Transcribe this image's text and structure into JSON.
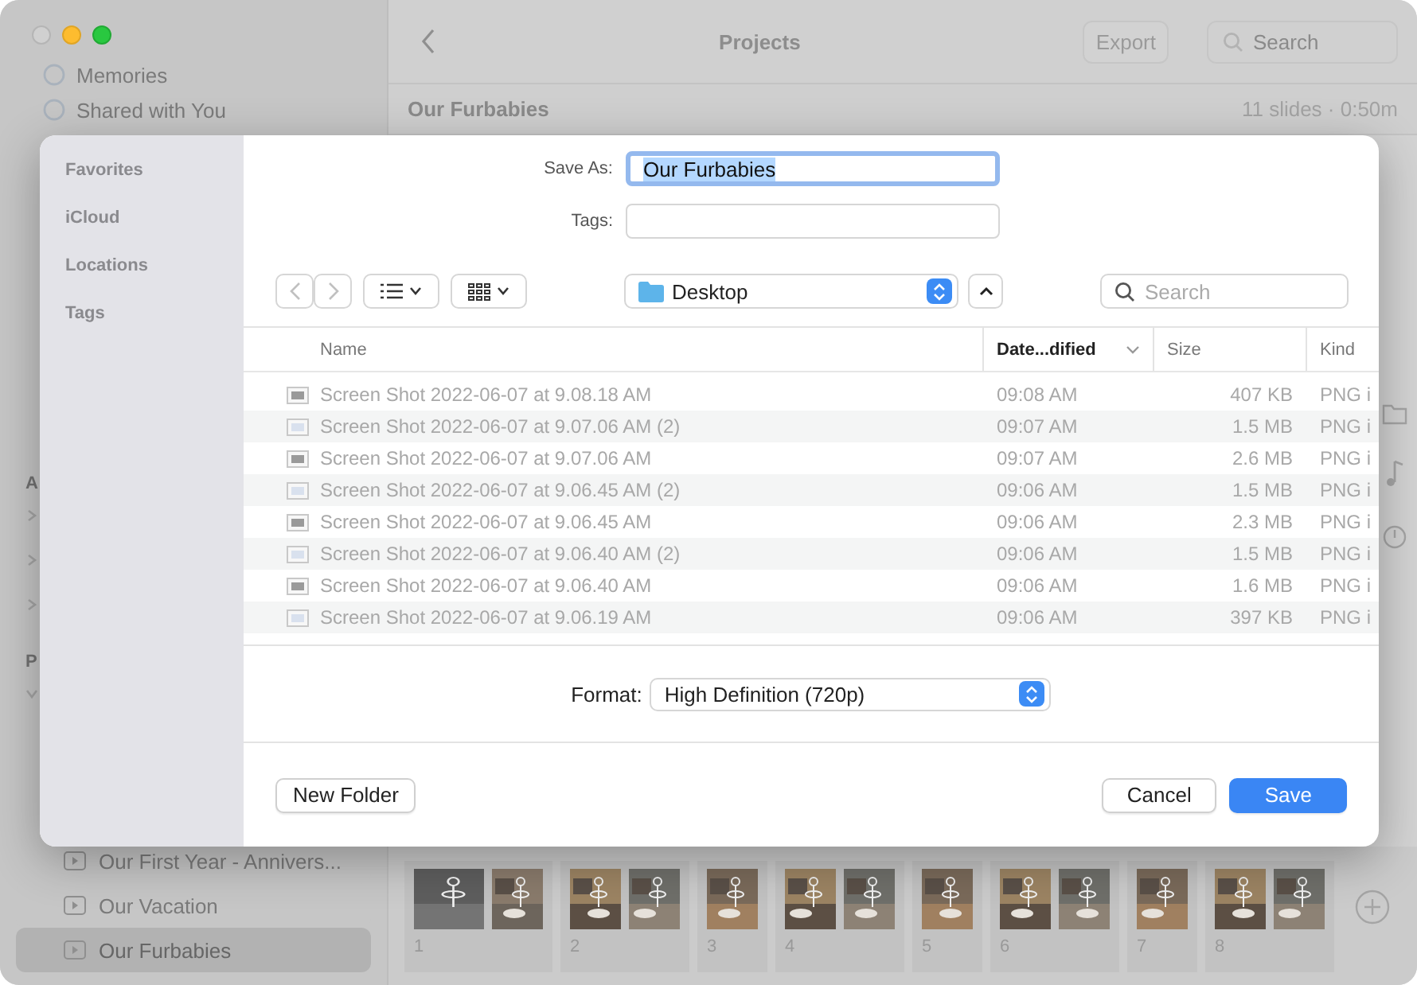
{
  "sidebar": {
    "top_items": [
      "Memories",
      "Shared with You"
    ],
    "section_1": {
      "heading": "A",
      "rows": [
        {
          "expanded": false
        },
        {
          "expanded": false
        },
        {
          "expanded": false
        }
      ]
    },
    "section_2": {
      "heading": "P",
      "expanded": true
    },
    "projects": [
      {
        "label": "Our First Year - Annivers...",
        "selected": false
      },
      {
        "label": "Our Vacation",
        "selected": false
      },
      {
        "label": "Our Furbabies",
        "selected": true
      }
    ]
  },
  "toolbar": {
    "title": "Projects",
    "export": "Export",
    "search_placeholder": "Search"
  },
  "project_header": {
    "title": "Our Furbabies",
    "info": "11 slides · 0:50m"
  },
  "slides": [
    {
      "number": "1"
    },
    {
      "number": "2"
    },
    {
      "number": "3"
    },
    {
      "number": "4"
    },
    {
      "number": "5"
    },
    {
      "number": "6"
    },
    {
      "number": "7"
    },
    {
      "number": "8"
    }
  ],
  "dialog": {
    "sidebar": [
      "Favorites",
      "iCloud",
      "Locations",
      "Tags"
    ],
    "save_as": {
      "label": "Save As:",
      "value": "Our Furbabies"
    },
    "tags": {
      "label": "Tags:"
    },
    "location": "Desktop",
    "search_placeholder": "Search",
    "columns": [
      {
        "label": "Name",
        "sorted": false
      },
      {
        "label": "Date...dified",
        "sorted": true
      },
      {
        "label": "Size",
        "sorted": false
      },
      {
        "label": "Kind",
        "sorted": false
      }
    ],
    "files": [
      {
        "name": "Screen Shot 2022-06-07 at 9.08.18 AM",
        "date": "09:08 AM",
        "size": "407 KB",
        "kind": "PNG i"
      },
      {
        "name": "Screen Shot 2022-06-07 at 9.07.06 AM (2)",
        "date": "09:07 AM",
        "size": "1.5 MB",
        "kind": "PNG i"
      },
      {
        "name": "Screen Shot 2022-06-07 at 9.07.06 AM",
        "date": "09:07 AM",
        "size": "2.6 MB",
        "kind": "PNG i"
      },
      {
        "name": "Screen Shot 2022-06-07 at 9.06.45 AM (2)",
        "date": "09:06 AM",
        "size": "1.5 MB",
        "kind": "PNG i"
      },
      {
        "name": "Screen Shot 2022-06-07 at 9.06.45 AM",
        "date": "09:06 AM",
        "size": "2.3 MB",
        "kind": "PNG i"
      },
      {
        "name": "Screen Shot 2022-06-07 at 9.06.40 AM (2)",
        "date": "09:06 AM",
        "size": "1.5 MB",
        "kind": "PNG i"
      },
      {
        "name": "Screen Shot 2022-06-07 at 9.06.40 AM",
        "date": "09:06 AM",
        "size": "1.6 MB",
        "kind": "PNG i"
      },
      {
        "name": "Screen Shot 2022-06-07 at 9.06.19 AM",
        "date": "09:06 AM",
        "size": "397 KB",
        "kind": "PNG i"
      }
    ],
    "format": {
      "label": "Format:",
      "value": "High Definition (720p)"
    },
    "buttons": {
      "new_folder": "New Folder",
      "cancel": "Cancel",
      "save": "Save"
    }
  }
}
